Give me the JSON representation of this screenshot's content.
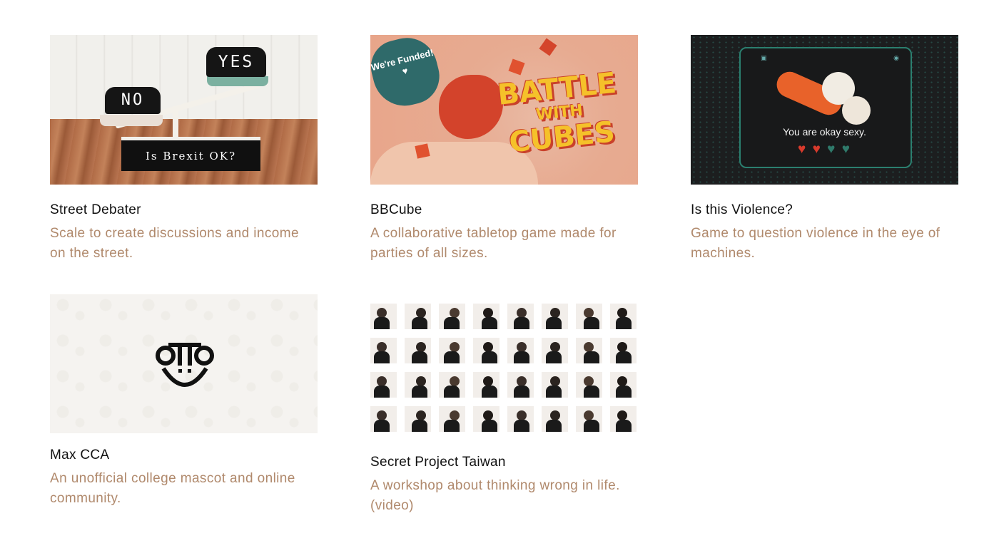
{
  "projects": [
    {
      "title": "Street Debater",
      "description": "Scale to create discussions and income on the street.",
      "thumb": {
        "sign_no": "NO",
        "sign_yes": "YES",
        "base_text": "Is Brexit OK?"
      }
    },
    {
      "title": "BBCube",
      "description": "A collaborative tabletop game made for parties of all sizes.",
      "thumb": {
        "badge": "We're Funded! ♥",
        "line1": "BATTLE",
        "line2": "WITH",
        "line3": "CUBES"
      }
    },
    {
      "title": "Is this Violence?",
      "description": "Game to question violence in the eye of machines.",
      "thumb": {
        "caption": "You are okay sexy.",
        "hearts_filled": 2,
        "hearts_total": 4,
        "heart_color": "#d83a2c",
        "heart_empty_color": "#2f7a6b"
      }
    },
    {
      "title": "Max CCA",
      "description": "An unofficial college mascot and online community.",
      "thumb": {
        "logo": "smiley-face-logo"
      }
    },
    {
      "title": "Secret Project Taiwan",
      "description": "A workshop about thinking wrong in life. (video)",
      "thumb": {
        "photo_count": 32
      }
    }
  ],
  "colors": {
    "title": "#111111",
    "description": "#b0896c"
  }
}
